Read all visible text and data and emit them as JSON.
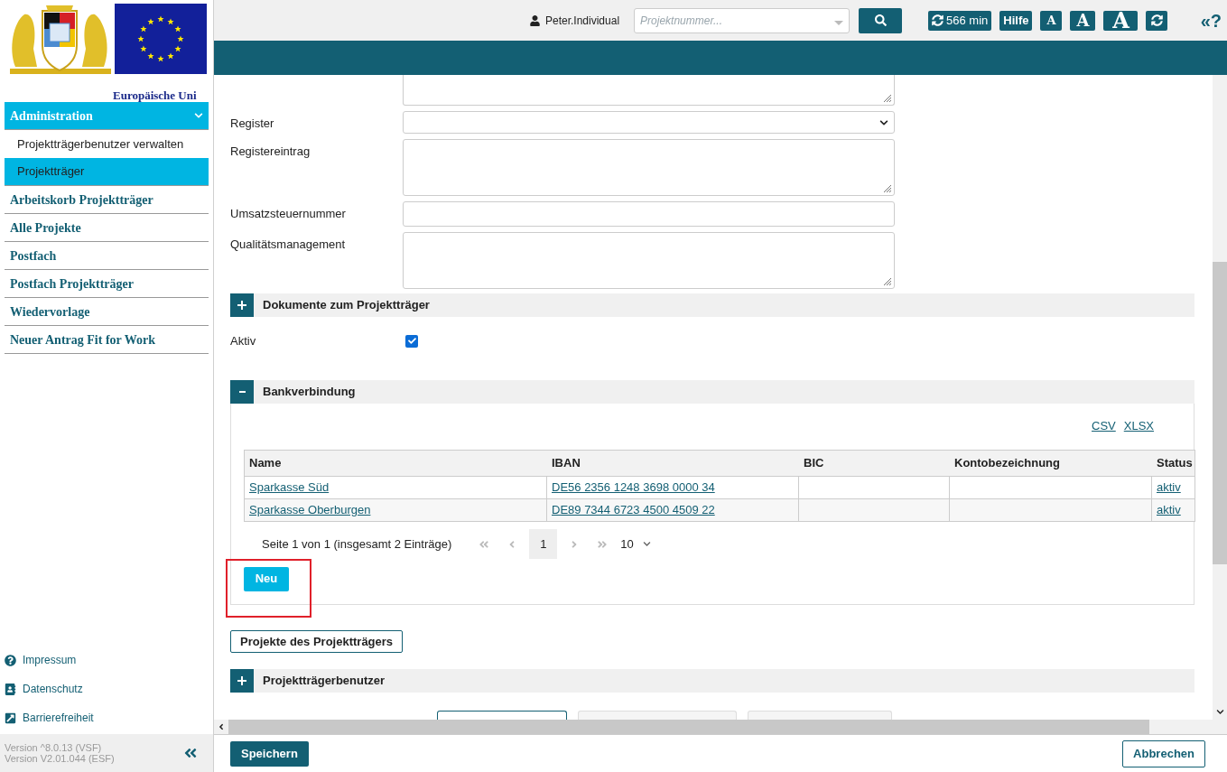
{
  "header": {
    "user": "Peter.Individual",
    "search_placeholder": "Projektnummer...",
    "session": "566 min",
    "help": "Hilfe",
    "font_sizes": [
      "A",
      "A",
      "A"
    ],
    "help_toggle": "«?"
  },
  "sidebar": {
    "eu_caption": "Europäische Uni",
    "menu": [
      {
        "label": "Administration",
        "expanded": true,
        "selected": true,
        "children": [
          {
            "label": "Projektträgerbenutzer verwalten",
            "selected": false
          },
          {
            "label": "Projektträger",
            "selected": true
          }
        ]
      },
      {
        "label": "Arbeitskorb Projektträger",
        "selected": false
      },
      {
        "label": "Alle Projekte",
        "selected": false
      },
      {
        "label": "Postfach",
        "selected": false
      },
      {
        "label": "Postfach Projektträger",
        "selected": false
      },
      {
        "label": "Wiedervorlage",
        "selected": false
      },
      {
        "label": "Neuer Antrag Fit for Work",
        "selected": false
      }
    ],
    "footer_links": [
      {
        "label": "Impressum",
        "kind": "help"
      },
      {
        "label": "Datenschutz",
        "kind": "privacy"
      },
      {
        "label": "Barrierefreiheit",
        "kind": "access"
      }
    ],
    "versions": [
      "Version ^8.0.13 (VSF)",
      "Version V2.01.044 (ESF)"
    ]
  },
  "form": {
    "fields": [
      {
        "kind": "partial_textarea"
      },
      {
        "label": "Register",
        "kind": "select"
      },
      {
        "label": "Registereintrag",
        "kind": "textarea"
      },
      {
        "label": "Umsatzsteuernummer",
        "kind": "input"
      },
      {
        "label": "Qualitätsmanagement",
        "kind": "textarea"
      }
    ]
  },
  "documents_section": {
    "title": "Dokumente zum Projektträger",
    "expanded": false
  },
  "active": {
    "label": "Aktiv",
    "checked": true
  },
  "bank_section": {
    "title": "Bankverbindung",
    "expanded": true,
    "exports": [
      "CSV",
      "XLSX"
    ],
    "columns": [
      "Name",
      "IBAN",
      "BIC",
      "Kontobezeichnung",
      "Status"
    ],
    "rows": [
      [
        "Sparkasse Süd",
        "DE56 2356 1248 3698 0000 34",
        "",
        "",
        "aktiv"
      ],
      [
        "Sparkasse Oberburgen",
        "DE89 7344 6723 4500 4509 22",
        "",
        "",
        "aktiv"
      ]
    ],
    "pagination": {
      "summary": "Seite 1 von 1 (insgesamt 2 Einträge)",
      "page": "1",
      "page_size": "10"
    },
    "new_button": "Neu",
    "highlighted": true
  },
  "projects_button": "Projekte des Projektträgers",
  "users_section": {
    "title": "Projektträgerbenutzer",
    "expanded": false
  },
  "footer": {
    "save": "Speichern",
    "cancel": "Abbrechen"
  }
}
